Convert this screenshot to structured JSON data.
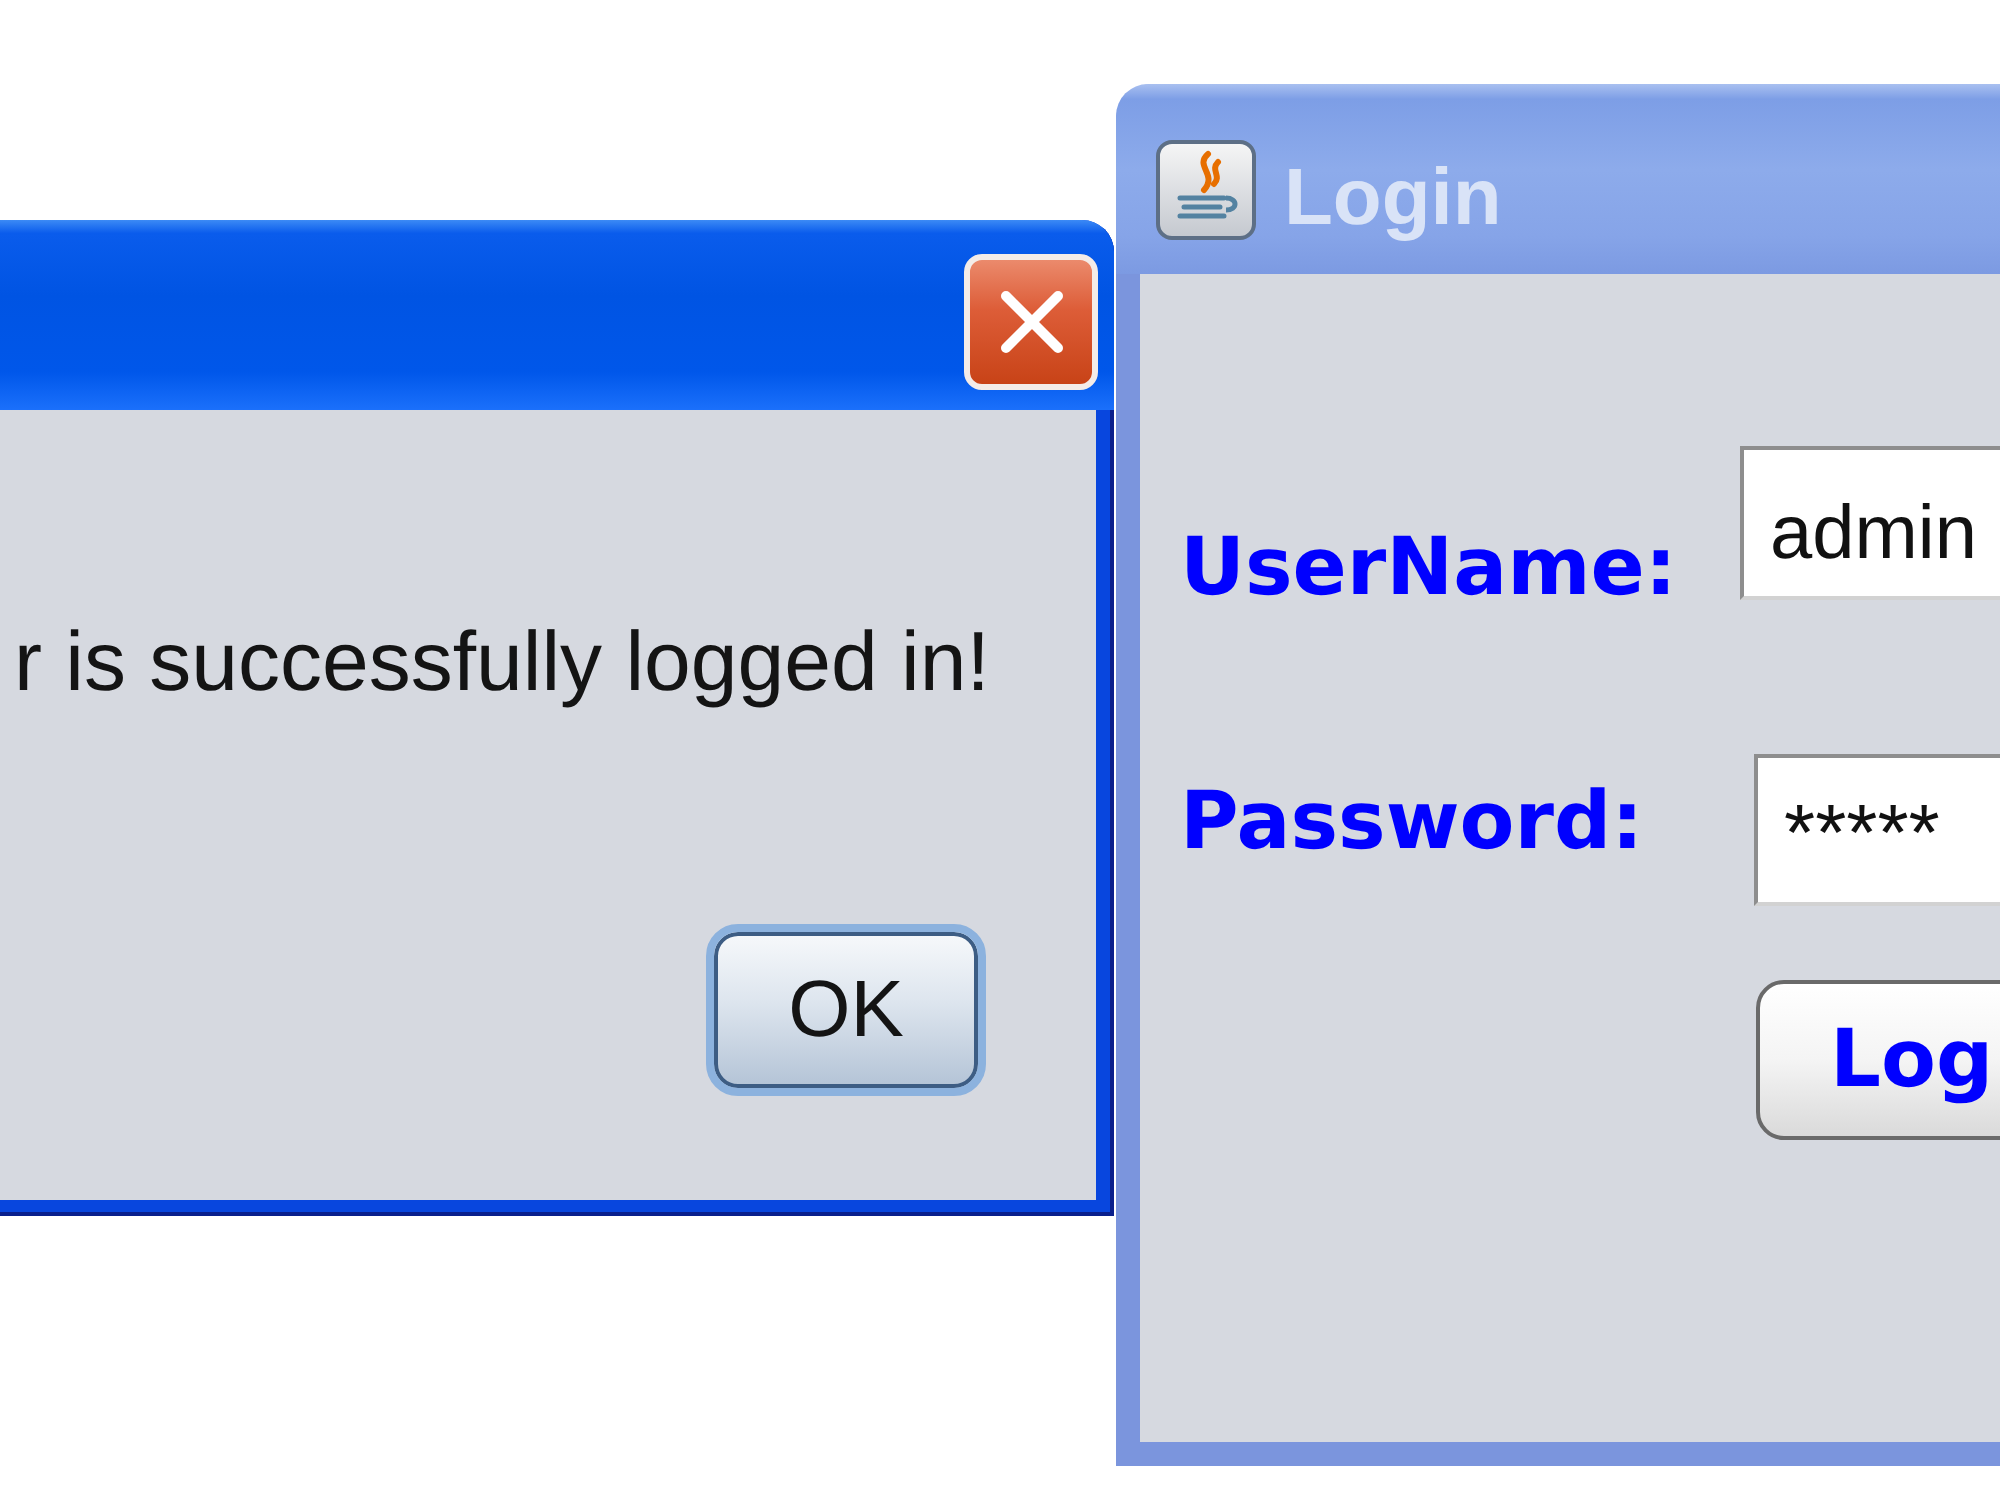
{
  "dialog": {
    "active": true,
    "message": "r is successfully logged in!",
    "ok_button": {
      "label": "OK",
      "focused": true
    }
  },
  "login_window": {
    "active": false,
    "title": "Login",
    "fields": [
      {
        "label": "UserName:",
        "value": "admin"
      },
      {
        "label": "Password:",
        "value": "*****"
      }
    ],
    "login_button": {
      "label": "Log"
    }
  }
}
